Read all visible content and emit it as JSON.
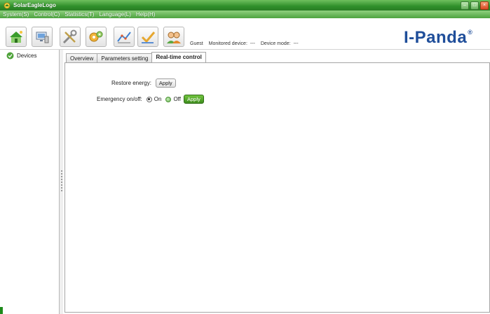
{
  "window": {
    "title": "SolarEagleLogo"
  },
  "menu": [
    "System(S)",
    "Control(C)",
    "Statistics(T)",
    "Language(L)",
    "Help(H)"
  ],
  "toolbar": {
    "buttons": [
      {
        "icon": "house-icon"
      },
      {
        "icon": "monitor-icon"
      },
      {
        "icon": "tools-icon"
      },
      {
        "icon": "gears-icon"
      },
      {
        "icon": "chart-icon"
      },
      {
        "icon": "checkmark-icon"
      },
      {
        "icon": "users-icon"
      }
    ],
    "status": {
      "user": "Guest",
      "monitored_device_label": "Monitored device:",
      "monitored_device_value": "---",
      "device_mode_label": "Device mode:",
      "device_mode_value": "---"
    },
    "brand": "I-Panda",
    "brand_mark": "®"
  },
  "sidebar": {
    "items": [
      {
        "label": "Devices",
        "icon": "device-icon"
      }
    ]
  },
  "tabs": [
    "Overview",
    "Parameters setting",
    "Real-time control"
  ],
  "active_tab": "Real-time control",
  "control": {
    "restore_label": "Restore energy:",
    "restore_apply": "Apply",
    "emergency_label": "Emergency on/off:",
    "on_label": "On",
    "off_label": "Off",
    "selected": "On",
    "emergency_apply": "Apply"
  },
  "colors": {
    "title_green": "#2f8f2a",
    "menu_green": "#4da33f",
    "brand_blue": "#1f4e9a",
    "apply_green": "#3e8d1d"
  }
}
